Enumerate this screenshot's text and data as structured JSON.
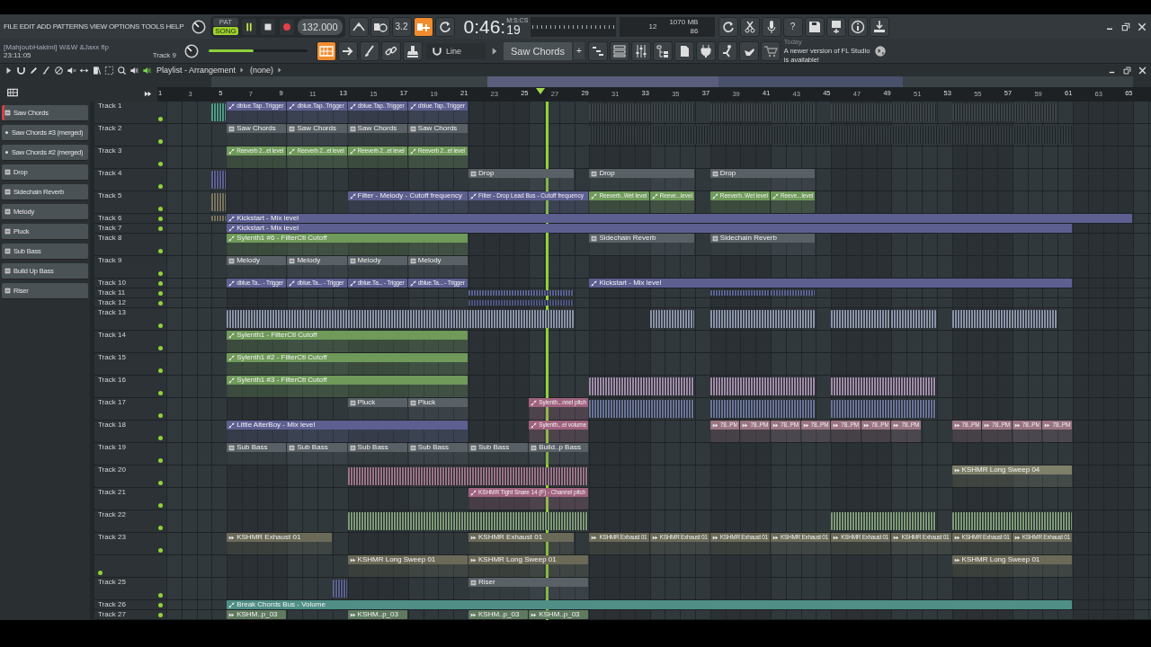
{
  "menu": [
    "FILE",
    "EDIT",
    "ADD",
    "PATTERNS",
    "VIEW",
    "OPTIONS",
    "TOOLS",
    "HELP"
  ],
  "transport": {
    "modes": [
      {
        "label": "PAT",
        "selected": false
      },
      {
        "label": "SONG",
        "selected": true
      }
    ],
    "playing": true,
    "tempo": "132.000"
  },
  "row1_tools": [
    {
      "on": false
    },
    {
      "on": false
    },
    {
      "label": "3.2",
      "on": false
    },
    {
      "on": true
    },
    {
      "on": false
    }
  ],
  "time": {
    "main": "0:46:",
    "sub": "19",
    "units": "M:S:CS"
  },
  "cpu": {
    "polyphony": "12",
    "memory": "1070 MB",
    "cpu": "86"
  },
  "help": {
    "label": "?"
  },
  "project": {
    "title": "[MahjoubHakimi] W&W &Jaxx flp",
    "clock": "23:11:05",
    "hint": "Track 9"
  },
  "master": {
    "level": 0.45
  },
  "row2_tools": [
    {
      "on": true
    },
    {
      "on": false
    },
    {
      "on": false
    },
    {
      "on": false
    },
    {
      "on": false
    }
  ],
  "snap": {
    "label": "Line"
  },
  "pattern_selector": {
    "label": "Saw Chords",
    "add": "+"
  },
  "news": {
    "date": "Today",
    "message": "A newer version of FL Studio is available!"
  },
  "playlist": {
    "title": "Playlist - Arrangement",
    "pattern": "(none)"
  },
  "ruler": [
    "1",
    "3",
    "5",
    "7",
    "9",
    "11",
    "13",
    "15",
    "17",
    "19",
    "21",
    "23",
    "25",
    "27",
    "29",
    "31",
    "33",
    "35",
    "37",
    "39",
    "41",
    "43",
    "45",
    "47",
    "49",
    "51",
    "53",
    "55",
    "57",
    "59",
    "61",
    "63",
    "65"
  ],
  "picker": [
    {
      "label": "Saw Chords",
      "kind": "pattern",
      "selected": true
    },
    {
      "label": "Saw Chords #3 (merged)",
      "kind": "merged",
      "selected": false
    },
    {
      "label": "Saw Chords #2 (merged)",
      "kind": "merged",
      "selected": false
    },
    {
      "label": "Drop",
      "kind": "pattern",
      "selected": false
    },
    {
      "label": "Sidechain Reverb",
      "kind": "pattern",
      "selected": false
    },
    {
      "label": "Melody",
      "kind": "pattern",
      "selected": false
    },
    {
      "label": "Pluck",
      "kind": "pattern",
      "selected": false
    },
    {
      "label": "Sub Bass",
      "kind": "pattern",
      "selected": false
    },
    {
      "label": "Build Up Bass",
      "kind": "pattern",
      "selected": false
    },
    {
      "label": "Riser",
      "kind": "pattern",
      "selected": false
    }
  ],
  "tracks": [
    {
      "name": "Track 1",
      "kind": "tall",
      "muted": false,
      "clips": [
        {
          "kind": "automation",
          "color": "#4f9a86"
        },
        {
          "label": "dblue.Tap..Trigger",
          "kind": "automation",
          "color": "#5d5f91"
        },
        {
          "label": "dblue.Tap..Trigger",
          "kind": "automation",
          "color": "#5d5f91"
        },
        {
          "label": "dblue.Tap..Trigger",
          "kind": "automation",
          "color": "#5d5f91"
        },
        {
          "label": "dblue.Tap..Trigger",
          "kind": "automation",
          "color": "#5d5f91"
        },
        {
          "kind": "pattern",
          "color": "#3c4347"
        },
        {
          "kind": "pattern",
          "color": "#3c4347"
        },
        {
          "kind": "pattern",
          "color": "#3c4347"
        },
        {
          "kind": "pattern",
          "color": "#3c4347"
        }
      ]
    },
    {
      "name": "Track 2",
      "kind": "tall",
      "muted": false,
      "clips": [
        {
          "label": "Saw Chords",
          "kind": "pattern",
          "color": "#596166"
        },
        {
          "label": "Saw Chords",
          "kind": "pattern",
          "color": "#596166"
        },
        {
          "label": "Saw Chords",
          "kind": "pattern",
          "color": "#596166"
        },
        {
          "label": "Saw Chords",
          "kind": "pattern",
          "color": "#596166"
        },
        {
          "kind": "pattern",
          "color": "#343b3f"
        }
      ]
    },
    {
      "name": "Track 3",
      "kind": "tall",
      "muted": false,
      "clips": [
        {
          "label": "Reeverb 2...et level",
          "kind": "automation",
          "color": "#6f9a5a"
        },
        {
          "label": "Reeverb 2...et level",
          "kind": "automation",
          "color": "#6f9a5a"
        },
        {
          "label": "Reeverb 2...et level",
          "kind": "automation",
          "color": "#6f9a5a"
        },
        {
          "label": "Reeverb 2...et level",
          "kind": "automation",
          "color": "#6f9a5a"
        }
      ]
    },
    {
      "name": "Track 4",
      "kind": "tall",
      "muted": false,
      "clips": [
        {
          "kind": "automation",
          "color": "#5d5f91"
        },
        {
          "label": "Drop",
          "kind": "pattern",
          "color": "#596166"
        },
        {
          "label": "Drop",
          "kind": "pattern",
          "color": "#596166"
        },
        {
          "label": "Drop",
          "kind": "pattern",
          "color": "#596166"
        }
      ]
    },
    {
      "name": "Track 5",
      "kind": "tall",
      "muted": false,
      "clips": [
        {
          "kind": "audio",
          "color": "#7a7460"
        },
        {
          "label": "Filter - Melody - Cutoff frequency",
          "kind": "automation",
          "color": "#5d5f91"
        },
        {
          "label": "Filter - Drop Lead Bus - Cutoff frequency",
          "kind": "automation",
          "color": "#5d5f91"
        },
        {
          "label": "Reeverb..Wet level",
          "kind": "automation",
          "color": "#6f9a5a"
        },
        {
          "label": "Reeve...level",
          "kind": "automation",
          "color": "#6f9a5a"
        },
        {
          "label": "Reeverb..Wet level",
          "kind": "automation",
          "color": "#6f9a5a"
        },
        {
          "label": "Reeve...level",
          "kind": "automation",
          "color": "#6f9a5a"
        }
      ]
    },
    {
      "name": "Track 6",
      "kind": "short",
      "muted": false,
      "clips": [
        {
          "kind": "audio",
          "color": "#7a7460"
        },
        {
          "label": "Kickstart - Mix level",
          "kind": "automation",
          "color": "#5d5f91"
        }
      ]
    },
    {
      "name": "Track 7",
      "kind": "short",
      "muted": false,
      "clips": [
        {
          "label": "Kickstart - Mix level",
          "kind": "automation",
          "color": "#5d5f91"
        }
      ]
    },
    {
      "name": "Track 8",
      "kind": "tall",
      "muted": false,
      "clips": [
        {
          "label": "Sylenth1 #6 - FilterCtl Cutoff",
          "kind": "automation",
          "color": "#6f9a5a"
        },
        {
          "label": "Sidechain Reverb",
          "kind": "pattern",
          "color": "#596166"
        },
        {
          "label": "Sidechain Reverb",
          "kind": "pattern",
          "color": "#596166"
        }
      ]
    },
    {
      "name": "Track 9",
      "kind": "tall",
      "muted": false,
      "clips": [
        {
          "label": "Melody",
          "kind": "pattern",
          "color": "#596166"
        },
        {
          "label": "Melody",
          "kind": "pattern",
          "color": "#596166"
        },
        {
          "label": "Melody",
          "kind": "pattern",
          "color": "#596166"
        },
        {
          "label": "Melody",
          "kind": "pattern",
          "color": "#596166"
        }
      ]
    },
    {
      "name": "Track 10",
      "kind": "short",
      "muted": false,
      "clips": [
        {
          "label": "dblue.Ta... - Trigger",
          "kind": "automation",
          "color": "#5d5f91"
        },
        {
          "label": "dblue.Ta... - Trigger",
          "kind": "automation",
          "color": "#5d5f91"
        },
        {
          "label": "dblue.Ta... - Trigger",
          "kind": "automation",
          "color": "#5d5f91"
        },
        {
          "label": "dblue.Ta... - Trigger",
          "kind": "automation",
          "color": "#5d5f91"
        },
        {
          "label": "Kickstart - Mix level",
          "kind": "automation",
          "color": "#5d5f91"
        }
      ]
    },
    {
      "name": "Track 11",
      "kind": "short",
      "muted": false,
      "clips": [
        {
          "kind": "audio",
          "color": "#5a6290"
        },
        {
          "kind": "audio",
          "color": "#5a6290"
        },
        {
          "kind": "audio",
          "color": "#5a6290"
        }
      ]
    },
    {
      "name": "Track 12",
      "kind": "short",
      "muted": false,
      "clips": [
        {
          "kind": "audio",
          "color": "#4d5580"
        }
      ]
    },
    {
      "name": "Track 13",
      "kind": "tall",
      "muted": false,
      "clips": [
        {
          "kind": "audio",
          "color": "#8a94a8"
        },
        {
          "kind": "audio",
          "color": "#8a94a8"
        },
        {
          "kind": "audio",
          "color": "#8a94a8"
        },
        {
          "kind": "audio",
          "color": "#8a94a8"
        },
        {
          "kind": "audio",
          "color": "#8a94a8"
        },
        {
          "kind": "audio",
          "color": "#8a94a8"
        }
      ]
    },
    {
      "name": "Track 14",
      "kind": "tall",
      "muted": false,
      "clips": [
        {
          "label": "Sylenth1 - FilterCtl Cutoff",
          "kind": "automation",
          "color": "#6f9a5a"
        }
      ]
    },
    {
      "name": "Track 15",
      "kind": "tall",
      "muted": false,
      "clips": [
        {
          "label": "Sylenth1 #2 - FilterCtl Cutoff",
          "kind": "automation",
          "color": "#6f9a5a"
        }
      ]
    },
    {
      "name": "Track 16",
      "kind": "tall",
      "muted": false,
      "clips": [
        {
          "label": "Sylenth1 #3 - FilterCtl Cutoff",
          "kind": "automation",
          "color": "#6f9a5a"
        },
        {
          "kind": "audio",
          "color": "#a08ca8"
        },
        {
          "kind": "audio",
          "color": "#a08ca8"
        },
        {
          "kind": "audio",
          "color": "#a08ca8"
        }
      ]
    },
    {
      "name": "Track 17",
      "kind": "tall",
      "muted": false,
      "clips": [
        {
          "label": "Pluck",
          "kind": "pattern",
          "color": "#596166"
        },
        {
          "label": "Pluck",
          "kind": "pattern",
          "color": "#596166"
        },
        {
          "label": "Sylenth...nnel pitch",
          "kind": "automation",
          "color": "#a0627f"
        },
        {
          "kind": "audio",
          "color": "#6a7498"
        },
        {
          "kind": "audio",
          "color": "#6a7498"
        },
        {
          "kind": "audio",
          "color": "#6a7498"
        }
      ]
    },
    {
      "name": "Track 18",
      "kind": "tall",
      "muted": false,
      "clips": [
        {
          "label": "Little AlterBoy - Mix level",
          "kind": "automation",
          "color": "#5d5f91"
        },
        {
          "label": "Sylenth...el volume",
          "kind": "automation",
          "color": "#a0627f"
        },
        {
          "label": "78..PM",
          "kind": "audio",
          "color": "#9a7482"
        },
        {
          "label": "78..PM",
          "kind": "audio",
          "color": "#9a7482"
        },
        {
          "label": "78..PM",
          "kind": "audio",
          "color": "#9a7482"
        },
        {
          "label": "78..PM",
          "kind": "audio",
          "color": "#9a7482"
        },
        {
          "label": "78..PM",
          "kind": "audio",
          "color": "#9a7482"
        },
        {
          "label": "78..PM",
          "kind": "audio",
          "color": "#9a7482"
        },
        {
          "label": "78..PM",
          "kind": "audio",
          "color": "#9a7482"
        },
        {
          "label": "78..PM",
          "kind": "audio",
          "color": "#9a7482"
        },
        {
          "label": "78..PM",
          "kind": "audio",
          "color": "#9a7482"
        },
        {
          "label": "78..PM",
          "kind": "audio",
          "color": "#9a7482"
        },
        {
          "label": "78..PM",
          "kind": "audio",
          "color": "#9a7482"
        }
      ]
    },
    {
      "name": "Track 19",
      "kind": "tall",
      "muted": false,
      "clips": [
        {
          "label": "Sub Bass",
          "kind": "pattern",
          "color": "#596166"
        },
        {
          "label": "Sub Bass",
          "kind": "pattern",
          "color": "#596166"
        },
        {
          "label": "Sub Bass",
          "kind": "pattern",
          "color": "#596166"
        },
        {
          "label": "Sub Bass",
          "kind": "pattern",
          "color": "#596166"
        },
        {
          "label": "Sub Bass",
          "kind": "pattern",
          "color": "#596166"
        },
        {
          "label": "Build..p Bass",
          "kind": "pattern",
          "color": "#596166"
        }
      ]
    },
    {
      "name": "Track 20",
      "kind": "tall",
      "muted": false,
      "clips": [
        {
          "kind": "audio",
          "color": "#9a7488"
        },
        {
          "label": "KSHMR Long Sweep 04",
          "kind": "audio",
          "color": "#7f806a"
        }
      ]
    },
    {
      "name": "Track 21",
      "kind": "tall",
      "muted": false,
      "clips": [
        {
          "label": "KSHMR Tight Snare 14 (F) - Channel pitch",
          "kind": "automation",
          "color": "#a0627f"
        }
      ]
    },
    {
      "name": "Track 22",
      "kind": "tall",
      "muted": false,
      "clips": [
        {
          "kind": "audio",
          "color": "#7e9a78"
        },
        {
          "kind": "audio",
          "color": "#7e9a78"
        },
        {
          "kind": "audio",
          "color": "#7e9a78"
        }
      ]
    },
    {
      "name": "Track 23",
      "kind": "tall",
      "muted": false,
      "clips": [
        {
          "label": "KSHMR Exhaust 01",
          "kind": "audio",
          "color": "#6b6a58"
        },
        {
          "label": "KSHMR Exhaust 01",
          "kind": "audio",
          "color": "#6b6a58"
        },
        {
          "label": "KSHMR Exhaust 01",
          "kind": "audio",
          "color": "#6b6a58"
        },
        {
          "label": "KSHMR Exhaust 01",
          "kind": "audio",
          "color": "#6b6a58"
        },
        {
          "label": "KSHMR Exhaust 01",
          "kind": "audio",
          "color": "#6b6a58"
        },
        {
          "label": "KSHMR Exhaust 01",
          "kind": "audio",
          "color": "#6b6a58"
        },
        {
          "label": "KSHMR Exhaust 01",
          "kind": "audio",
          "color": "#6b6a58"
        },
        {
          "label": "KSHMR Exhaust 01",
          "kind": "audio",
          "color": "#6b6a58"
        },
        {
          "label": "KSHMR Exhaust 01",
          "kind": "audio",
          "color": "#6b6a58"
        },
        {
          "label": "KSHMR Exhaust 01",
          "kind": "audio",
          "color": "#6b6a58"
        }
      ]
    },
    {
      "kind": "tall",
      "muted": false,
      "clips": [
        {
          "label": "KSHMR Long Sweep 01",
          "kind": "audio",
          "color": "#6b6a58"
        },
        {
          "label": "KSHMR Long Sweep 01",
          "kind": "audio",
          "color": "#6b6a58"
        },
        {
          "label": "KSHMR Long Sweep 01",
          "kind": "audio",
          "color": "#6b6a58"
        }
      ]
    },
    {
      "name": "Track 25",
      "kind": "tall",
      "muted": false,
      "clips": [
        {
          "kind": "audio",
          "color": "#5a6290"
        },
        {
          "label": "Riser",
          "kind": "pattern",
          "color": "#596166"
        }
      ]
    },
    {
      "name": "Track 26",
      "kind": "short",
      "muted": false,
      "clips": [
        {
          "label": "Break Chords Bus - Volume",
          "kind": "automation",
          "color": "#4f8f86"
        }
      ]
    },
    {
      "name": "Track 27",
      "kind": "short",
      "muted": false,
      "clips": [
        {
          "label": "KSHM..p_03",
          "kind": "audio",
          "color": "#5f7a5f"
        },
        {
          "label": "KSHM..p_03",
          "kind": "audio",
          "color": "#5f7a5f"
        },
        {
          "label": "KSHM..p_03",
          "kind": "audio",
          "color": "#5f7a5f"
        },
        {
          "label": "KSHM..p_03",
          "kind": "audio",
          "color": "#5f7a5f"
        }
      ]
    }
  ]
}
